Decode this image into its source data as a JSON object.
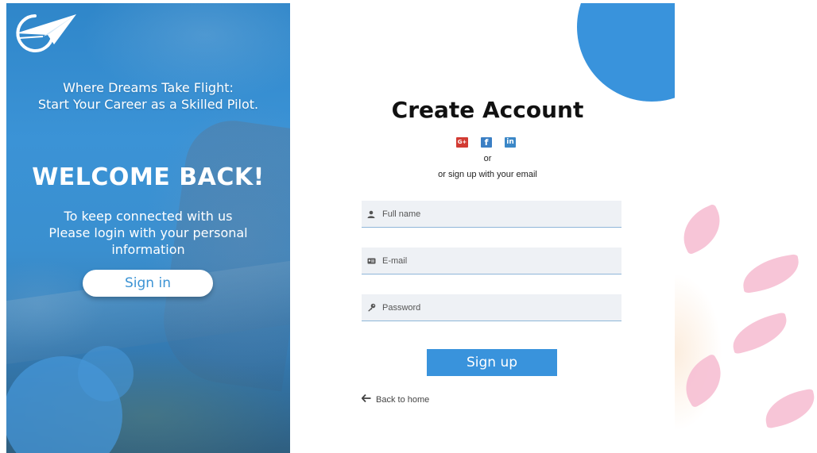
{
  "left_panel": {
    "logo_icon": "paper-plane-circle-icon",
    "tagline_line1": "Where Dreams Take Flight:",
    "tagline_line2": "Start Your Career as a Skilled Pilot.",
    "welcome_title": "WELCOME BACK!",
    "message_line1": "To keep connected with us",
    "message_line2": "Please login with your personal",
    "message_line3": "information",
    "signin_label": "Sign in"
  },
  "form": {
    "title": "Create Account",
    "social": {
      "google_label": "G+",
      "facebook_label": "f",
      "linkedin_label": "in"
    },
    "or_text": "or",
    "email_hint": "or sign up with your email",
    "fields": {
      "full_name": {
        "placeholder": "Full name",
        "value": "",
        "icon": "user-icon"
      },
      "email": {
        "placeholder": "E-mail",
        "value": "",
        "icon": "id-card-icon"
      },
      "password": {
        "placeholder": "Password",
        "value": "",
        "icon": "key-icon"
      }
    },
    "signup_label": "Sign up",
    "back_label": "Back to home",
    "back_icon": "arrow-left-icon"
  },
  "colors": {
    "accent": "#3993dc",
    "left_panel": "#3b93d6",
    "petal": "#f6bfd3",
    "google": "#d23b33",
    "facebook": "#3b7fc4",
    "linkedin": "#3b87c7"
  }
}
